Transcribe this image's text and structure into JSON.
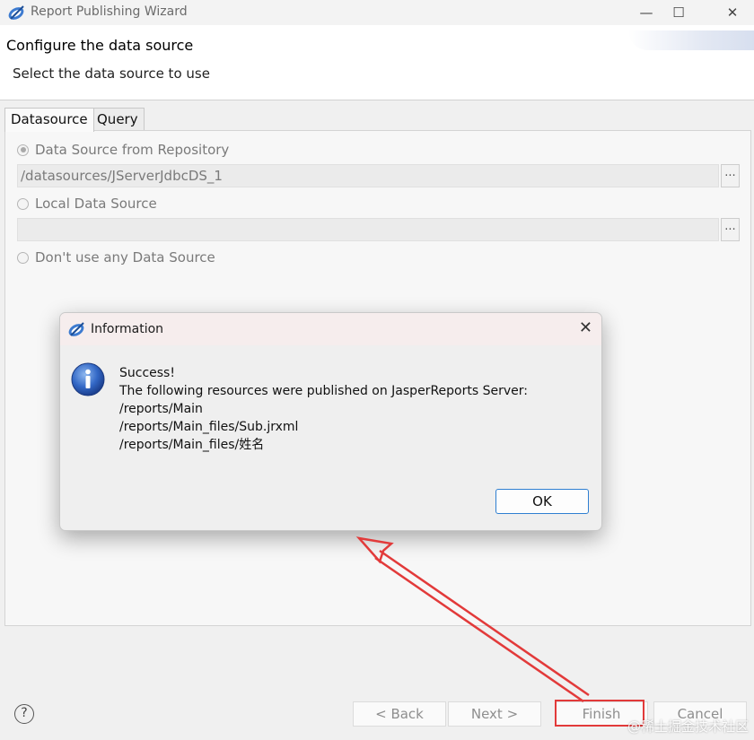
{
  "window": {
    "title": "Report Publishing Wizard",
    "minimize": "—",
    "maximize": "☐",
    "close": "✕"
  },
  "header": {
    "title": "Configure the data source",
    "subtitle": "Select the data source to use"
  },
  "tabs": [
    {
      "label": "Datasource",
      "active": true
    },
    {
      "label": "Query",
      "active": false
    }
  ],
  "datasource": {
    "option_repository": "Data Source from Repository",
    "repository_value": "/datasources/JServerJdbcDS_1",
    "option_local": "Local Data Source",
    "local_value": "",
    "option_none": "Don't use any Data Source",
    "browse": "...",
    "selected": "repository"
  },
  "dialog": {
    "title": "Information",
    "close": "✕",
    "lines": [
      "Success!",
      "The following resources were published on JasperReports Server:",
      "/reports/Main",
      "/reports/Main_files/Sub.jrxml",
      "/reports/Main_files/姓名"
    ],
    "ok_label": "OK"
  },
  "footer": {
    "help": "?",
    "back": "< Back",
    "next": "Next >",
    "finish": "Finish",
    "cancel": "Cancel"
  },
  "watermark": "@稀土掘金技术社区",
  "colors": {
    "accent": "#2f7fd1",
    "annotation": "#e23a3a"
  }
}
